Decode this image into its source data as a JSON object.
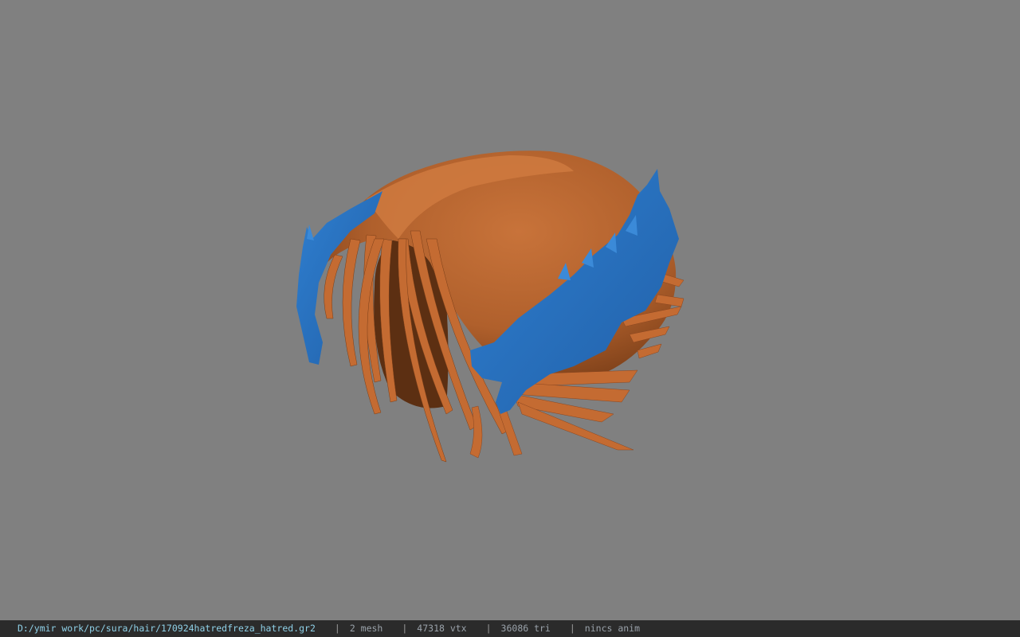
{
  "viewport": {
    "background_color": "#808080",
    "model": {
      "hair_color": "#c46b32",
      "hair_shadow_color": "#5a2e12",
      "accessory_color": "#2f74c0"
    }
  },
  "status_bar": {
    "file_path": "D:/ymir work/pc/sura/hair/170924hatredfreza_hatred.gr2",
    "separator": "|",
    "mesh_count": "2 mesh",
    "vertex_count": "47318 vtx",
    "triangle_count": "36086 tri",
    "animation": "nincs anim"
  }
}
